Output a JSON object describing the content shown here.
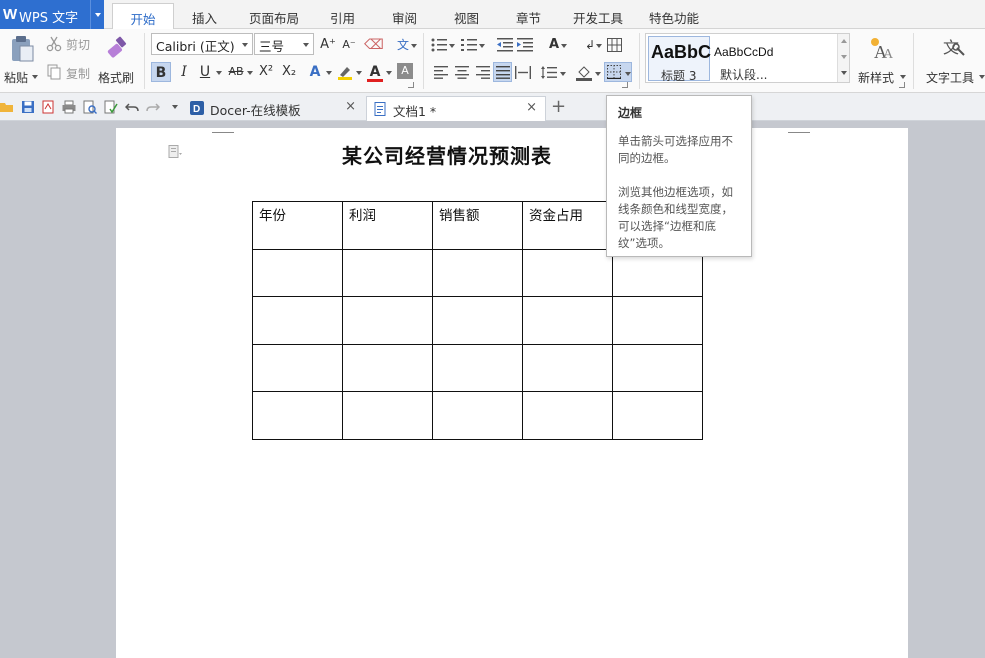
{
  "app": {
    "name": "WPS 文字"
  },
  "menu": {
    "tabs": [
      "开始",
      "插入",
      "页面布局",
      "引用",
      "审阅",
      "视图",
      "章节",
      "开发工具",
      "特色功能"
    ],
    "active": "开始"
  },
  "ribbon": {
    "paste": "粘贴",
    "cut": "剪切",
    "copy": "复制",
    "format_painter": "格式刷",
    "font_name": "Calibri (正文)",
    "font_size": "三号",
    "bold": "B",
    "italic": "I",
    "underline": "U",
    "strike": "AB",
    "superscript": "X²",
    "subscript": "X₂",
    "grow_font": "A⁺",
    "shrink_font": "A⁻",
    "styles": [
      {
        "sample": "AaBbC",
        "name": "标题 3"
      },
      {
        "sample": "AaBbCcDd",
        "name": "默认段..."
      }
    ],
    "new_style": "新样式",
    "text_tools": "文字工具"
  },
  "doc_tabs": [
    {
      "title": "Docer-在线模板",
      "active": false
    },
    {
      "title": "文档1 *",
      "active": true
    }
  ],
  "document": {
    "title": "某公司经营情况预测表",
    "table": {
      "headers": [
        "年份",
        "利润",
        "销售额",
        "资金占用",
        ""
      ],
      "rows": [
        [
          "",
          "",
          "",
          "",
          ""
        ],
        [
          "",
          "",
          "",
          "",
          ""
        ],
        [
          "",
          "",
          "",
          "",
          ""
        ],
        [
          "",
          "",
          "",
          "",
          ""
        ]
      ]
    }
  },
  "tooltip": {
    "title": "边框",
    "line1": "单击箭头可选择应用不同的边框。",
    "line2": "浏览其他边框选项，如线条颜色和线型宽度，可以选择“边框和底纹”选项。"
  },
  "colors": {
    "accent": "#2e6fd0",
    "workspace": "#c5c8cf",
    "font_color": "#e02020",
    "highlight": "#f5d000"
  }
}
